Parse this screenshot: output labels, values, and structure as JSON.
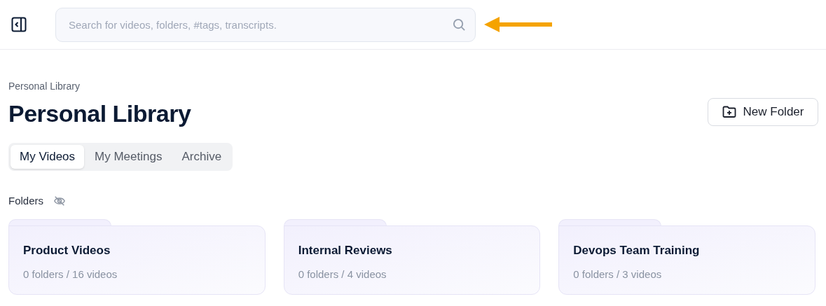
{
  "search": {
    "placeholder": "Search for videos, folders, #tags, transcripts."
  },
  "breadcrumb": "Personal Library",
  "title": "Personal Library",
  "new_folder_button": "New Folder",
  "tabs": [
    {
      "label": "My Videos",
      "selected": true
    },
    {
      "label": "My Meetings",
      "selected": false
    },
    {
      "label": "Archive",
      "selected": false
    }
  ],
  "folders_heading": "Folders",
  "folders": [
    {
      "name": "Product Videos",
      "meta": "0 folders / 16 videos"
    },
    {
      "name": "Internal Reviews",
      "meta": "0 folders / 4 videos"
    },
    {
      "name": "Devops Team Training",
      "meta": "0 folders / 3 videos"
    }
  ]
}
